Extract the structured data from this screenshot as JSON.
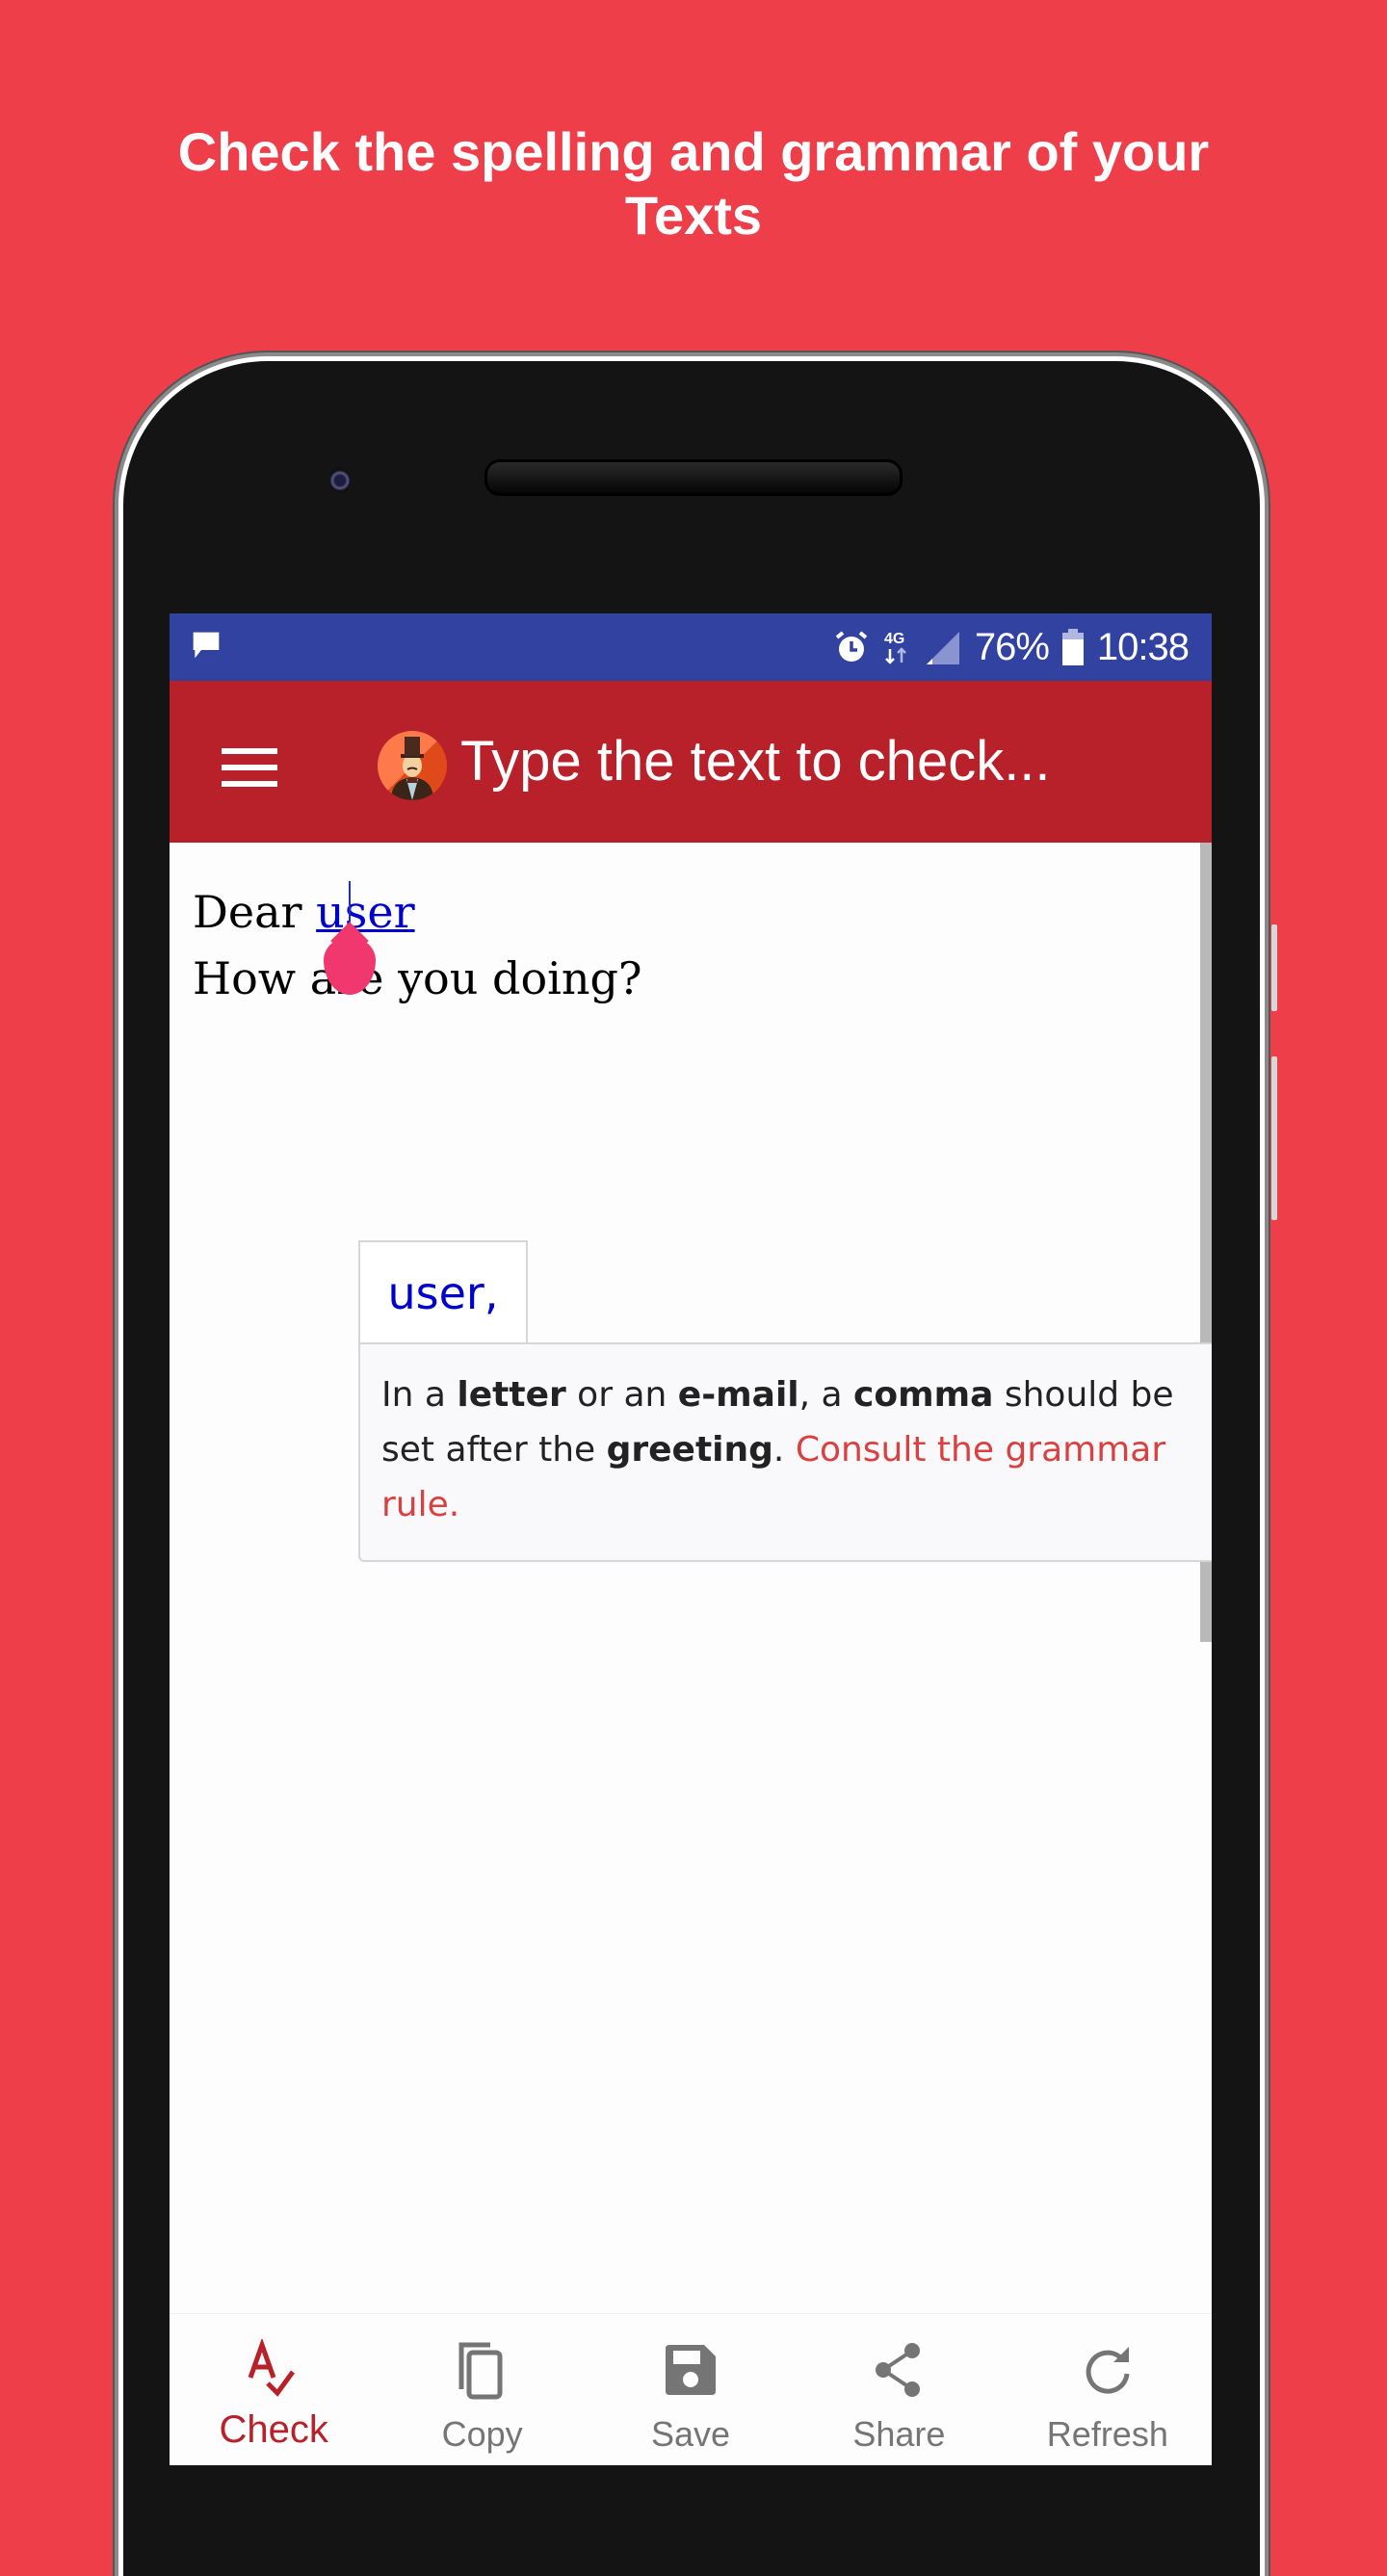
{
  "promo": {
    "title_line1": "Check the spelling and grammar of your",
    "title_line2": "Texts"
  },
  "status_bar": {
    "left_icons": [
      "message-icon"
    ],
    "right_icons": [
      "alarm-icon",
      "4g-data-icon",
      "signal-icon",
      "battery-icon"
    ],
    "network": "4G",
    "battery_percent": "76%",
    "time": "10:38"
  },
  "app_bar": {
    "menu_icon": "hamburger-menu-icon",
    "avatar_icon": "gentleman-avatar-icon",
    "title": "Type the text to check..."
  },
  "editor": {
    "line1_prefix": "Dear ",
    "line1_error_word": "user",
    "line2": "How are you doing?",
    "suggestion": "user,",
    "explanation": {
      "part1": "In a ",
      "bold1": "letter",
      "part2": " or an ",
      "bold2": "e-mail",
      "part3": ", a ",
      "bold3": "comma",
      "part4": " should be set after the ",
      "bold4": "greeting",
      "part5": ". ",
      "link": "Consult the grammar rule."
    }
  },
  "bottom_nav": {
    "items": [
      {
        "label": "Check",
        "icon": "spellcheck-icon",
        "active": true
      },
      {
        "label": "Copy",
        "icon": "copy-icon",
        "active": false
      },
      {
        "label": "Save",
        "icon": "save-floppy-icon",
        "active": false
      },
      {
        "label": "Share",
        "icon": "share-icon",
        "active": false
      },
      {
        "label": "Refresh",
        "icon": "refresh-icon",
        "active": false
      }
    ]
  },
  "colors": {
    "background": "#EE3E4A",
    "status_bar": "#3142A0",
    "app_bar": "#B8202A",
    "error_word": "#0000CC",
    "link": "#D94040",
    "cursor_handle": "#F0386E",
    "nav_active": "#B8202A",
    "nav_inactive": "#757575"
  }
}
